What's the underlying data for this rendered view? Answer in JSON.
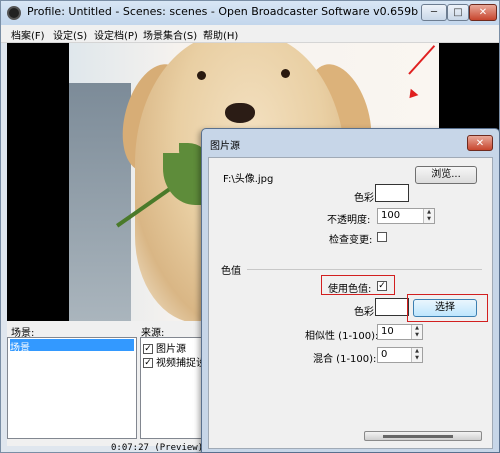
{
  "main": {
    "title": "Profile: Untitled - Scenes: scenes - Open Broadcaster Software v0.659b",
    "controls": {
      "minimize": "─",
      "maximize": "□",
      "close": "✕"
    },
    "menu": [
      "档案(F)",
      "设定(S)",
      "设定档(P)",
      "场景集合(S)",
      "帮助(H)"
    ]
  },
  "scenes": {
    "label": "场景:",
    "items": [
      "场景"
    ]
  },
  "sources": {
    "label": "来源:",
    "items": [
      {
        "name": "图片源",
        "checked": true
      },
      {
        "name": "视频捕捉设",
        "checked": true
      }
    ]
  },
  "status": {
    "time": "0:07:27 (Preview)"
  },
  "dialog": {
    "title": "图片源",
    "close": "✕",
    "file_path": "F:\\头像.jpg",
    "browse_button": "浏览...",
    "color_label": "色彩",
    "opacity_label": "不透明度:",
    "opacity_value": "100",
    "monitor_label": "检查变更:",
    "group_title": "色值",
    "use_color_key_label": "使用色值:",
    "use_color_key_checked": "✓",
    "key_color_label": "色彩",
    "select_button": "选择",
    "similarity_label": "相似性 (1-100):",
    "similarity_value": "10",
    "blend_label": "混合 (1-100):",
    "blend_value": "0"
  },
  "colors": {
    "annotation_red": "#d21f1f",
    "titlebar": "#c3d6ec",
    "selection": "#3399ff"
  }
}
